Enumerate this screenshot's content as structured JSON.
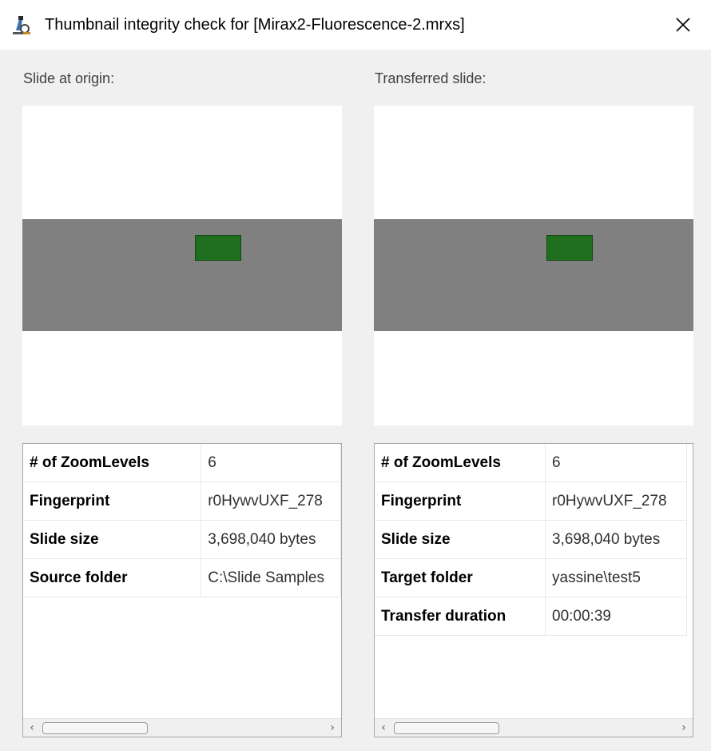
{
  "window": {
    "title": "Thumbnail integrity check for [Mirax2-Fluorescence-2.mrxs]",
    "icon": "microscope-icon",
    "close_label": "✕"
  },
  "origin": {
    "label": "Slide at origin:",
    "rows": [
      {
        "key": "# of ZoomLevels",
        "value": "6"
      },
      {
        "key": "Fingerprint",
        "value": "r0HywvUXF_278"
      },
      {
        "key": "Slide size",
        "value": "3,698,040 bytes"
      },
      {
        "key": "Source folder",
        "value": "C:\\Slide Samples"
      }
    ]
  },
  "transferred": {
    "label": "Transferred slide:",
    "rows": [
      {
        "key": "# of ZoomLevels",
        "value": "6"
      },
      {
        "key": "Fingerprint",
        "value": "r0HywvUXF_278"
      },
      {
        "key": "Slide size",
        "value": "3,698,040 bytes"
      },
      {
        "key": "Target folder",
        "value": "yassine\\test5"
      },
      {
        "key": "Transfer duration",
        "value": "00:00:39"
      }
    ]
  },
  "scroll": {
    "left_arrow": "‹",
    "right_arrow": "›"
  },
  "colors": {
    "thumb_band": "#808080",
    "tissue": "#1e6e1e"
  }
}
